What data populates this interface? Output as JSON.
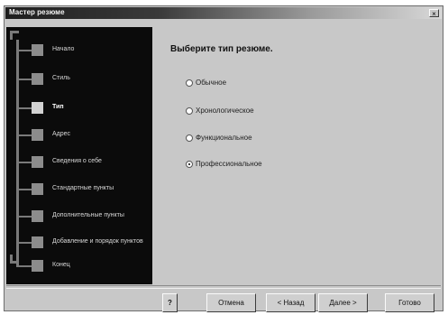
{
  "window": {
    "title": "Мастер резюме",
    "close_label": "×"
  },
  "nav": {
    "steps": [
      {
        "label": "Начало",
        "current": false
      },
      {
        "label": "Стиль",
        "current": false
      },
      {
        "label": "Тип",
        "current": true
      },
      {
        "label": "Адрес",
        "current": false
      },
      {
        "label": "Сведения о себе",
        "current": false
      },
      {
        "label": "Стандартные пункты",
        "current": false
      },
      {
        "label": "Дополнительные пункты",
        "current": false
      },
      {
        "label": "Добавление и порядок пунктов",
        "current": false
      },
      {
        "label": "Конец",
        "current": false
      }
    ]
  },
  "content": {
    "title": "Выберите тип резюме.",
    "options": [
      {
        "label": "Обычное",
        "selected": false
      },
      {
        "label": "Хронологическое",
        "selected": false
      },
      {
        "label": "Функциональное",
        "selected": false
      },
      {
        "label": "Профессиональное",
        "selected": true
      }
    ]
  },
  "footer": {
    "help_label": "?",
    "cancel_label": "Отмена",
    "back_label": "< Назад",
    "next_label": "Далее >",
    "finish_label": "Готово"
  }
}
